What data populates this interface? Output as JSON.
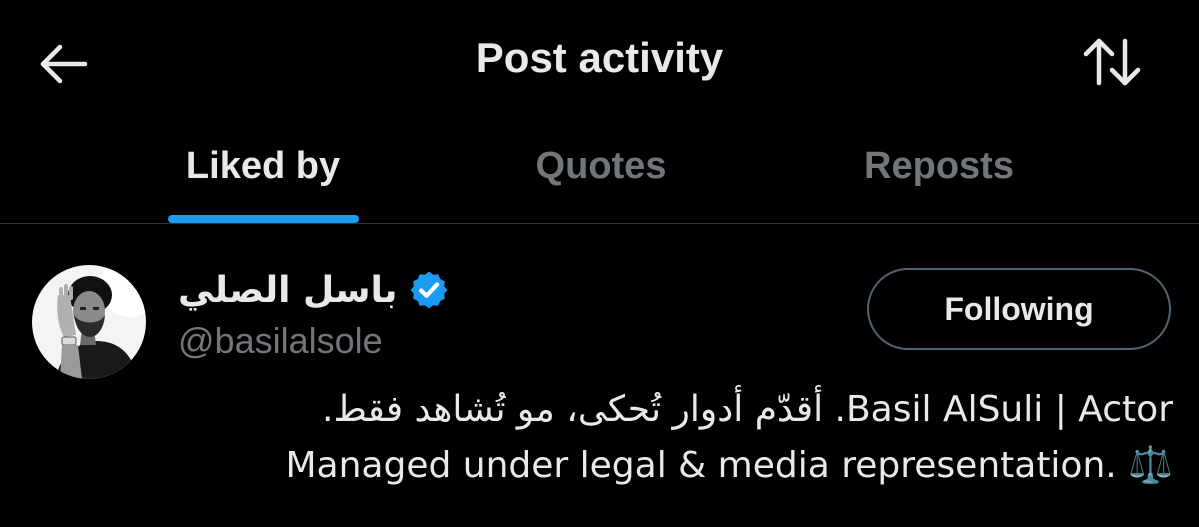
{
  "header": {
    "title": "Post activity",
    "back_icon": "arrow-left-icon",
    "sort_icon": "sort-arrows-icon"
  },
  "tabs": [
    {
      "label": "Liked by",
      "active": true
    },
    {
      "label": "Quotes",
      "active": false
    },
    {
      "label": "Reposts",
      "active": false
    }
  ],
  "colors": {
    "background": "#000000",
    "text_primary": "#e7e9ea",
    "text_secondary": "#71767b",
    "accent": "#1d9bf0",
    "divider": "#2f3336",
    "button_border": "#536471"
  },
  "user": {
    "display_name": "باسل الصلي",
    "verified": true,
    "handle": "@basilalsole",
    "follow_button_label": "Following",
    "bio_line_1": "Basil AlSuli | Actor. أقدّم أدوار تُحكى، مو تُشاهد فقط.",
    "bio_line_2": "⚖️ .Managed under legal & media representation"
  }
}
